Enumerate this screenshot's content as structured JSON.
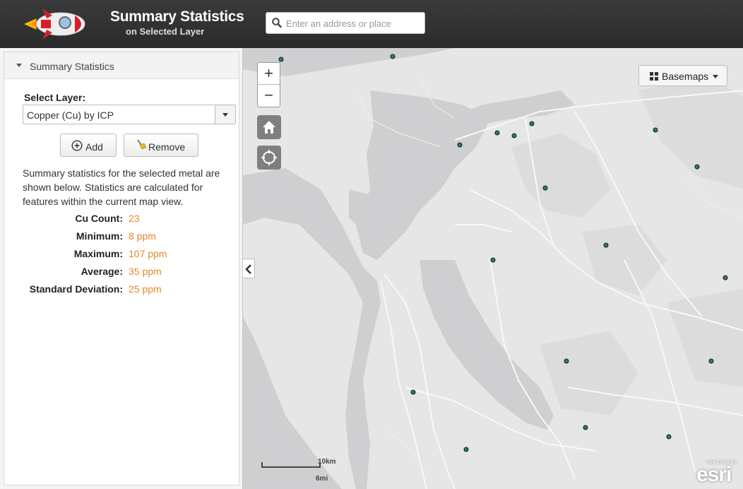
{
  "header": {
    "title": "Summary Statistics",
    "subtitle": "on Selected Layer",
    "search_placeholder": "Enter an address or place"
  },
  "panel": {
    "title": "Summary Statistics",
    "select_label": "Select Layer:",
    "select_value": "Copper (Cu) by ICP",
    "add_label": "Add",
    "remove_label": "Remove",
    "description": "Summary statistics for the selected metal are shown below. Statistics are calculated for features within the current map view.",
    "stats": [
      {
        "label": "Cu Count:",
        "value": "23"
      },
      {
        "label": "Minimum:",
        "value": "8 ppm"
      },
      {
        "label": "Maximum:",
        "value": "107 ppm"
      },
      {
        "label": "Average:",
        "value": "35 ppm"
      },
      {
        "label": "Standard Deviation:",
        "value": "25 ppm"
      }
    ]
  },
  "map": {
    "zoom_in": "+",
    "zoom_out": "−",
    "basemaps_label": "Basemaps",
    "scale_km": "10km",
    "scale_mi": "6mi",
    "attribution_powered": "POWERED BY",
    "attribution_brand": "esri",
    "colors": {
      "water": "#cfcfd1",
      "land": "#e6e6e6",
      "point": "#2c7a6e",
      "accent": "#e8872a"
    }
  }
}
